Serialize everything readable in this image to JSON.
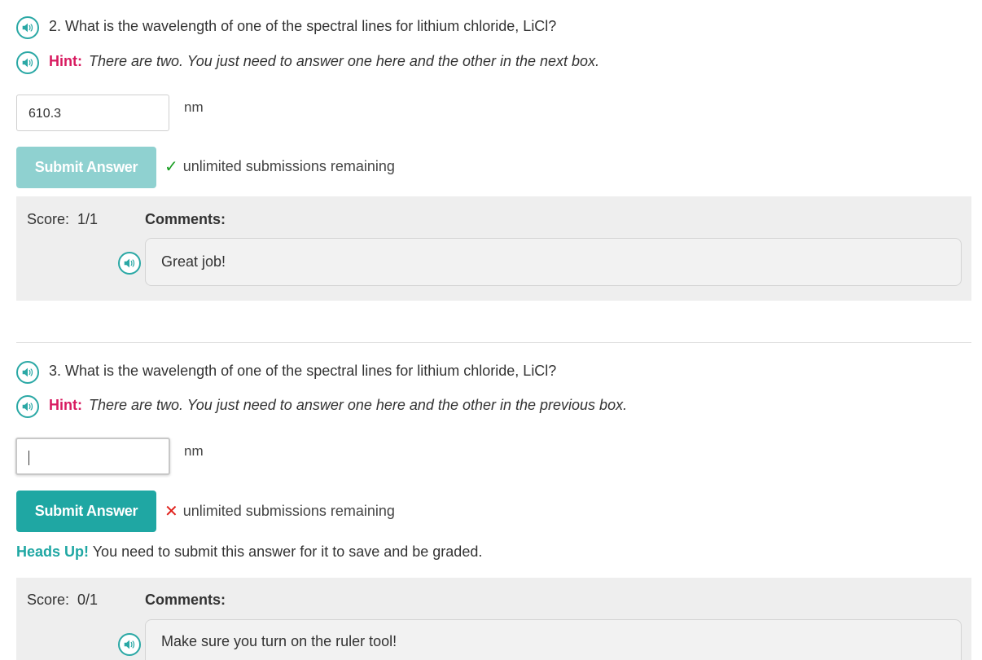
{
  "q2": {
    "question": "2. What is the wavelength of one of the spectral lines for lithium chloride, LiCl?",
    "hint_label": "Hint:",
    "hint_text": "There are two. You just need to answer one here and the other in the next box.",
    "answer_value": "610.3",
    "unit": "nm",
    "submit_label": "Submit Answer",
    "status_text": "unlimited submissions remaining",
    "score_label": "Score:",
    "score_value": "1/1",
    "comments_label": "Comments:",
    "comment": "Great job!"
  },
  "q3": {
    "question": "3. What is the wavelength of one of the spectral lines for lithium chloride, LiCl?",
    "hint_label": "Hint:",
    "hint_text": "There are two. You just need to answer one here and the other in the previous box.",
    "answer_value": "",
    "unit": "nm",
    "submit_label": "Submit Answer",
    "status_text": "unlimited submissions remaining",
    "headsup_label": "Heads Up!",
    "headsup_text": "You need to submit this answer for it to save and be graded.",
    "score_label": "Score:",
    "score_value": "0/1",
    "comments_label": "Comments:",
    "comment": "Make sure you turn on the ruler tool!"
  },
  "icons": {
    "speaker": "speaker-icon",
    "check": "check-icon",
    "cross": "cross-icon"
  },
  "colors": {
    "accent": "#1fa7a3",
    "accent_disabled": "#8fd1d0",
    "hint": "#d81b60",
    "correct": "#1a9e23",
    "incorrect": "#e0201b",
    "panel": "#eeeeee"
  }
}
